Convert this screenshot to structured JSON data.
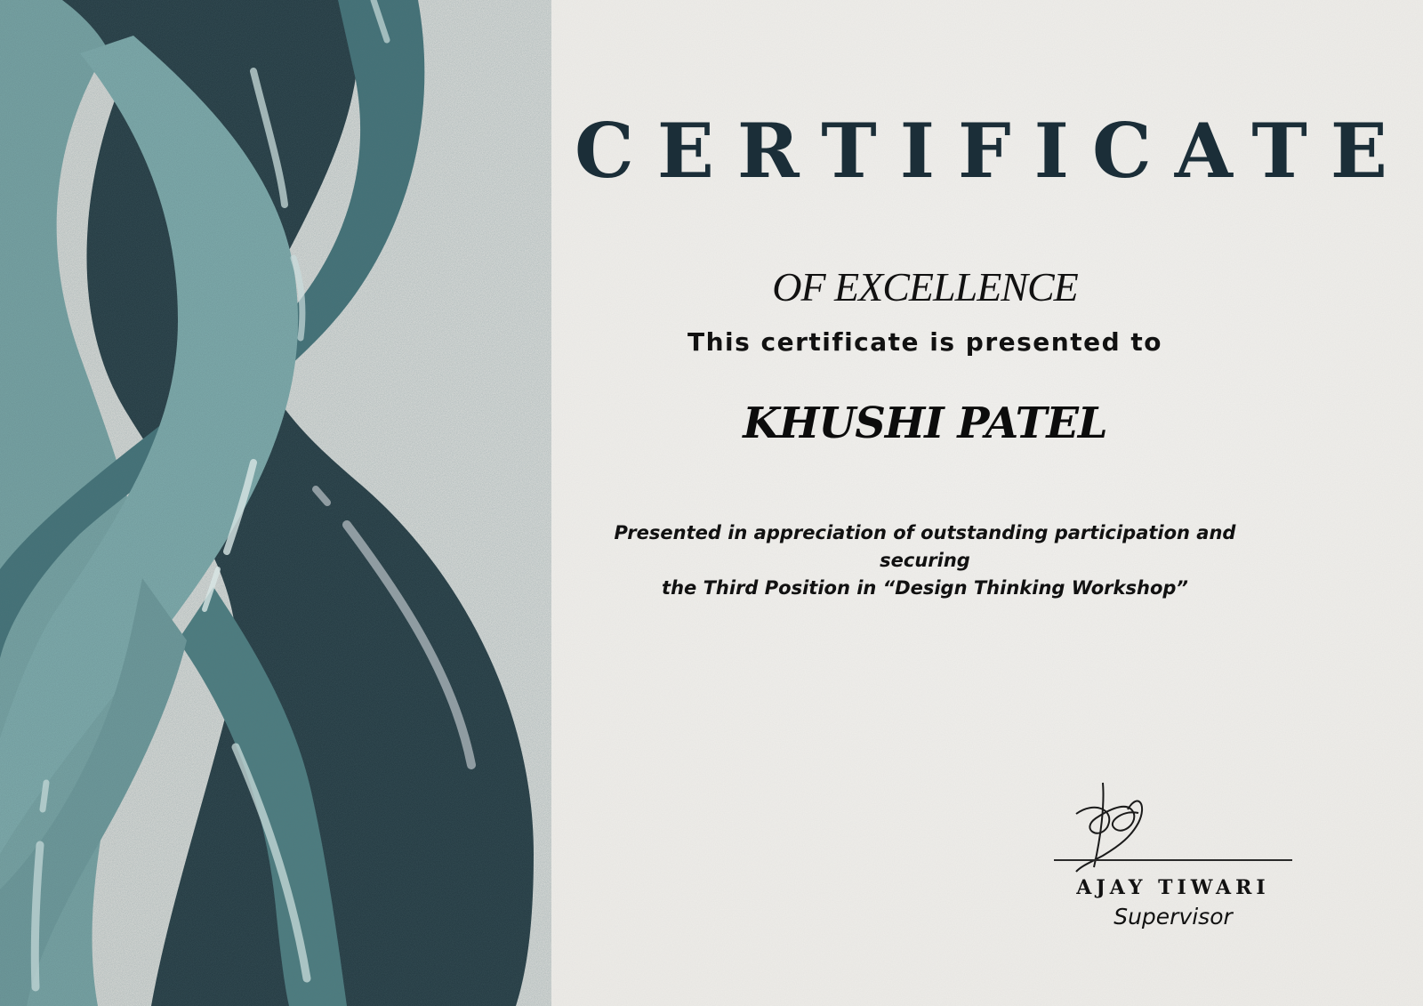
{
  "certificate": {
    "title": "CERTIFICATE",
    "subtitle": "OF EXCELLENCE",
    "presented_line": "This certificate is presented to",
    "recipient": "KHUSHI PATEL",
    "reason_line1": "Presented in appreciation of outstanding participation and securing",
    "reason_line2": "the Third Position in “Design Thinking Workshop”"
  },
  "signatory": {
    "name": "AJAY TIWARI",
    "role": "Supervisor",
    "signature_text": "Ajay Tiwari"
  },
  "colors": {
    "paper": "#eeece8",
    "title": "#1b2e38",
    "teal_dark": "#1d323a",
    "teal_mid": "#3f7076",
    "teal_light": "#7aa8a8"
  }
}
